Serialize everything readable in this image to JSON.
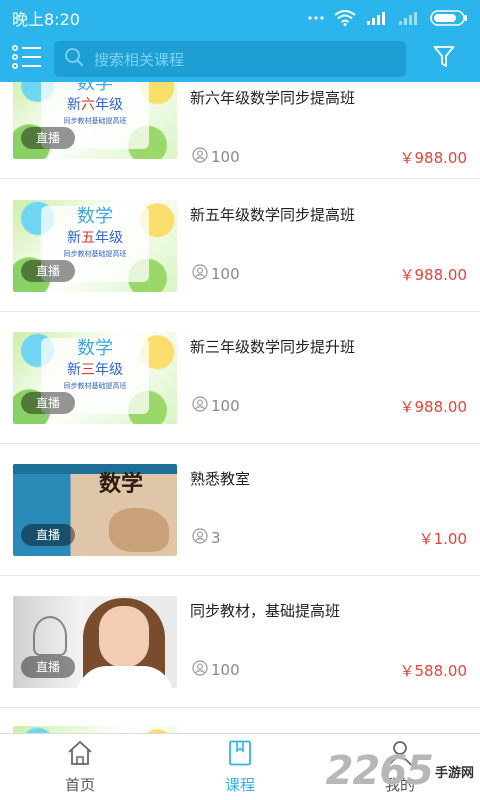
{
  "status_bar": {
    "time": "晚上8:20"
  },
  "app_bar": {
    "search_placeholder": "搜索相关课程"
  },
  "courses": [
    {
      "title": "新六年级数学同步提高班",
      "students": "100",
      "price": "￥988.00",
      "badge": "直播",
      "thumb": {
        "t1": "数学",
        "t2a": "新",
        "t2b": "六",
        "t2c": "年级",
        "t3": "同步教材基础提高班"
      }
    },
    {
      "title": "新五年级数学同步提高班",
      "students": "100",
      "price": "￥988.00",
      "badge": "直播",
      "thumb": {
        "t1": "数学",
        "t2a": "新",
        "t2b": "五",
        "t2c": "年级",
        "t3": "同步教材基础提高班"
      }
    },
    {
      "title": "新三年级数学同步提升班",
      "students": "100",
      "price": "￥988.00",
      "badge": "直播",
      "thumb": {
        "t1": "数学",
        "t2a": "新",
        "t2b": "三",
        "t2c": "年级",
        "t3": "同步教材基础提高班"
      }
    },
    {
      "title": "熟悉教室",
      "students": "3",
      "price": "￥1.00",
      "badge": "直播",
      "thumb": {
        "t1": "数学"
      }
    },
    {
      "title": "同步教材，基础提高班",
      "students": "100",
      "price": "￥588.00",
      "badge": "直播"
    }
  ],
  "bottom_nav": [
    {
      "label": "首页",
      "icon": "home-icon"
    },
    {
      "label": "课程",
      "icon": "book-icon",
      "active": true
    },
    {
      "label": "我的",
      "icon": "user-icon"
    }
  ],
  "watermark": {
    "number": "2265",
    "text": "手游网"
  },
  "colors": {
    "accent": "#2bb5ec",
    "price": "#e8423b"
  }
}
